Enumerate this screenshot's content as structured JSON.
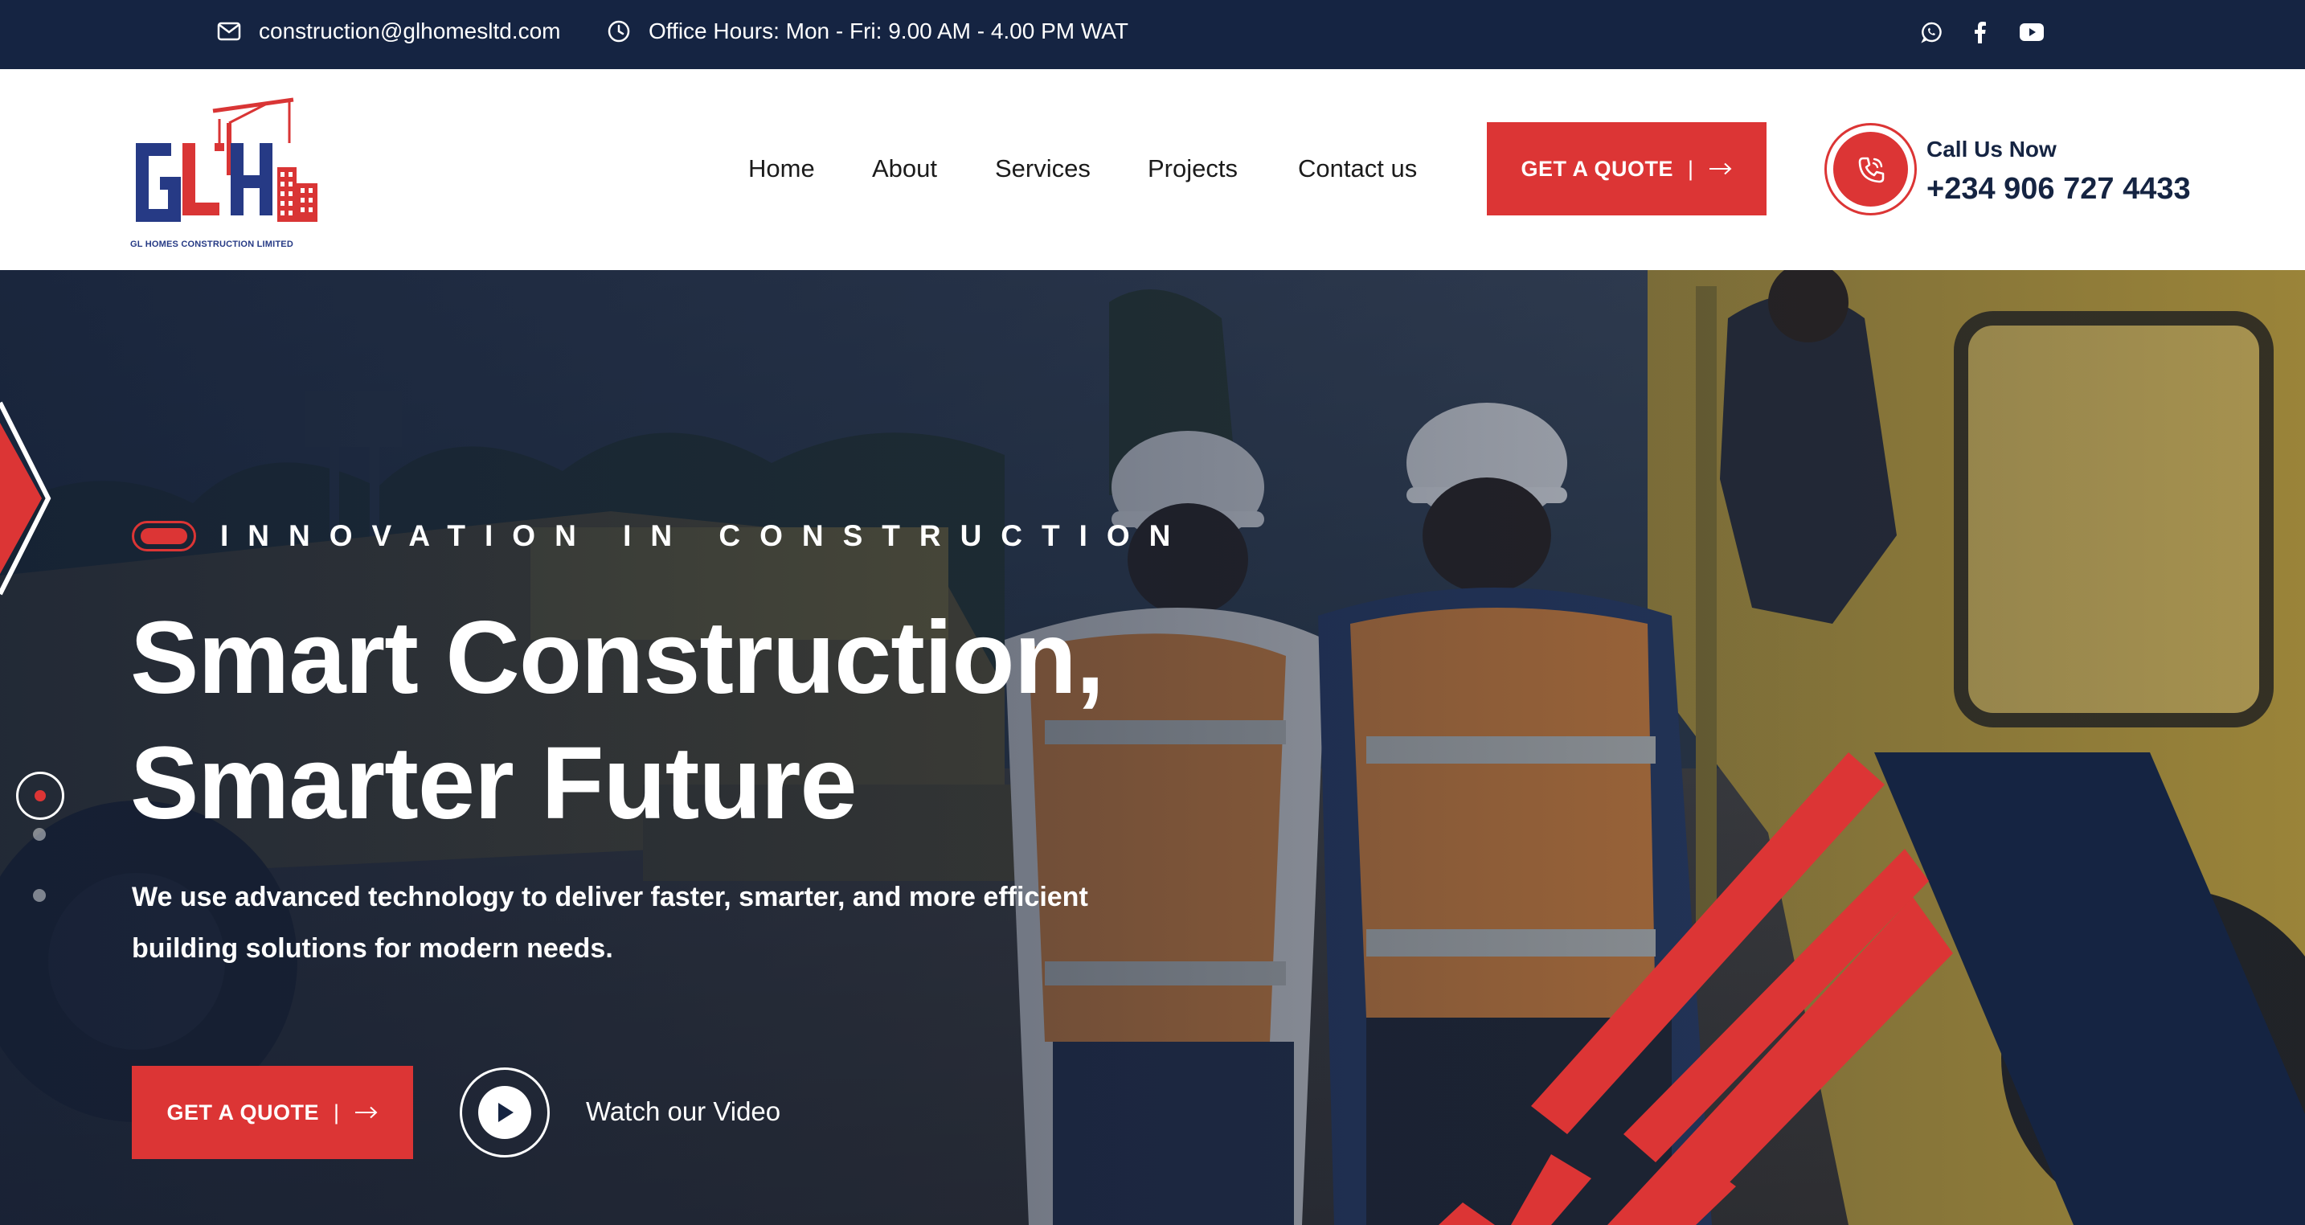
{
  "topbar": {
    "email": "construction@glhomesltd.com",
    "hours": "Office Hours: Mon - Fri: 9.00 AM - 4.00 PM WAT",
    "social": [
      "whatsapp-icon",
      "facebook-icon",
      "youtube-icon"
    ]
  },
  "logo": {
    "tagline": "GL HOMES CONSTRUCTION LIMITED"
  },
  "nav": {
    "items": [
      {
        "label": "Home"
      },
      {
        "label": "About"
      },
      {
        "label": "Services"
      },
      {
        "label": "Projects"
      },
      {
        "label": "Contact us"
      }
    ]
  },
  "header": {
    "quote_label": "GET A QUOTE",
    "call_label": "Call Us Now",
    "call_number": "+234 906 727 4433"
  },
  "hero": {
    "eyebrow": "INNOVATION IN CONSTRUCTION",
    "headline_line1": "Smart Construction,",
    "headline_line2": "Smarter Future",
    "subtext": "We use advanced technology to deliver faster, smarter, and more efficient building solutions for modern needs.",
    "quote_label": "GET A QUOTE",
    "watch_label": "Watch our Video",
    "slides_total": 3,
    "slide_active": 1
  },
  "colors": {
    "navy": "#152442",
    "red": "#dc3535",
    "white": "#ffffff"
  }
}
